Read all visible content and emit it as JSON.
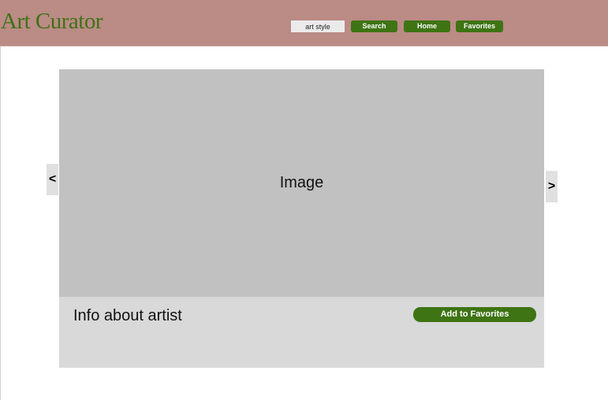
{
  "header": {
    "logo": "Art Curator",
    "search": {
      "value": "art style"
    },
    "nav": {
      "search_label": "Search",
      "home_label": "Home",
      "favorites_label": "Favorites"
    }
  },
  "main": {
    "image_placeholder": "Image",
    "artist_info": "Info about artist",
    "add_to_favorites_label": "Add to Favorites",
    "prev_label": "<",
    "next_label": ">"
  },
  "colors": {
    "header_bg": "#bb8b86",
    "accent_green": "#3e7413",
    "image_bg": "#c1c1c1",
    "info_bg": "#d9d9d9"
  }
}
